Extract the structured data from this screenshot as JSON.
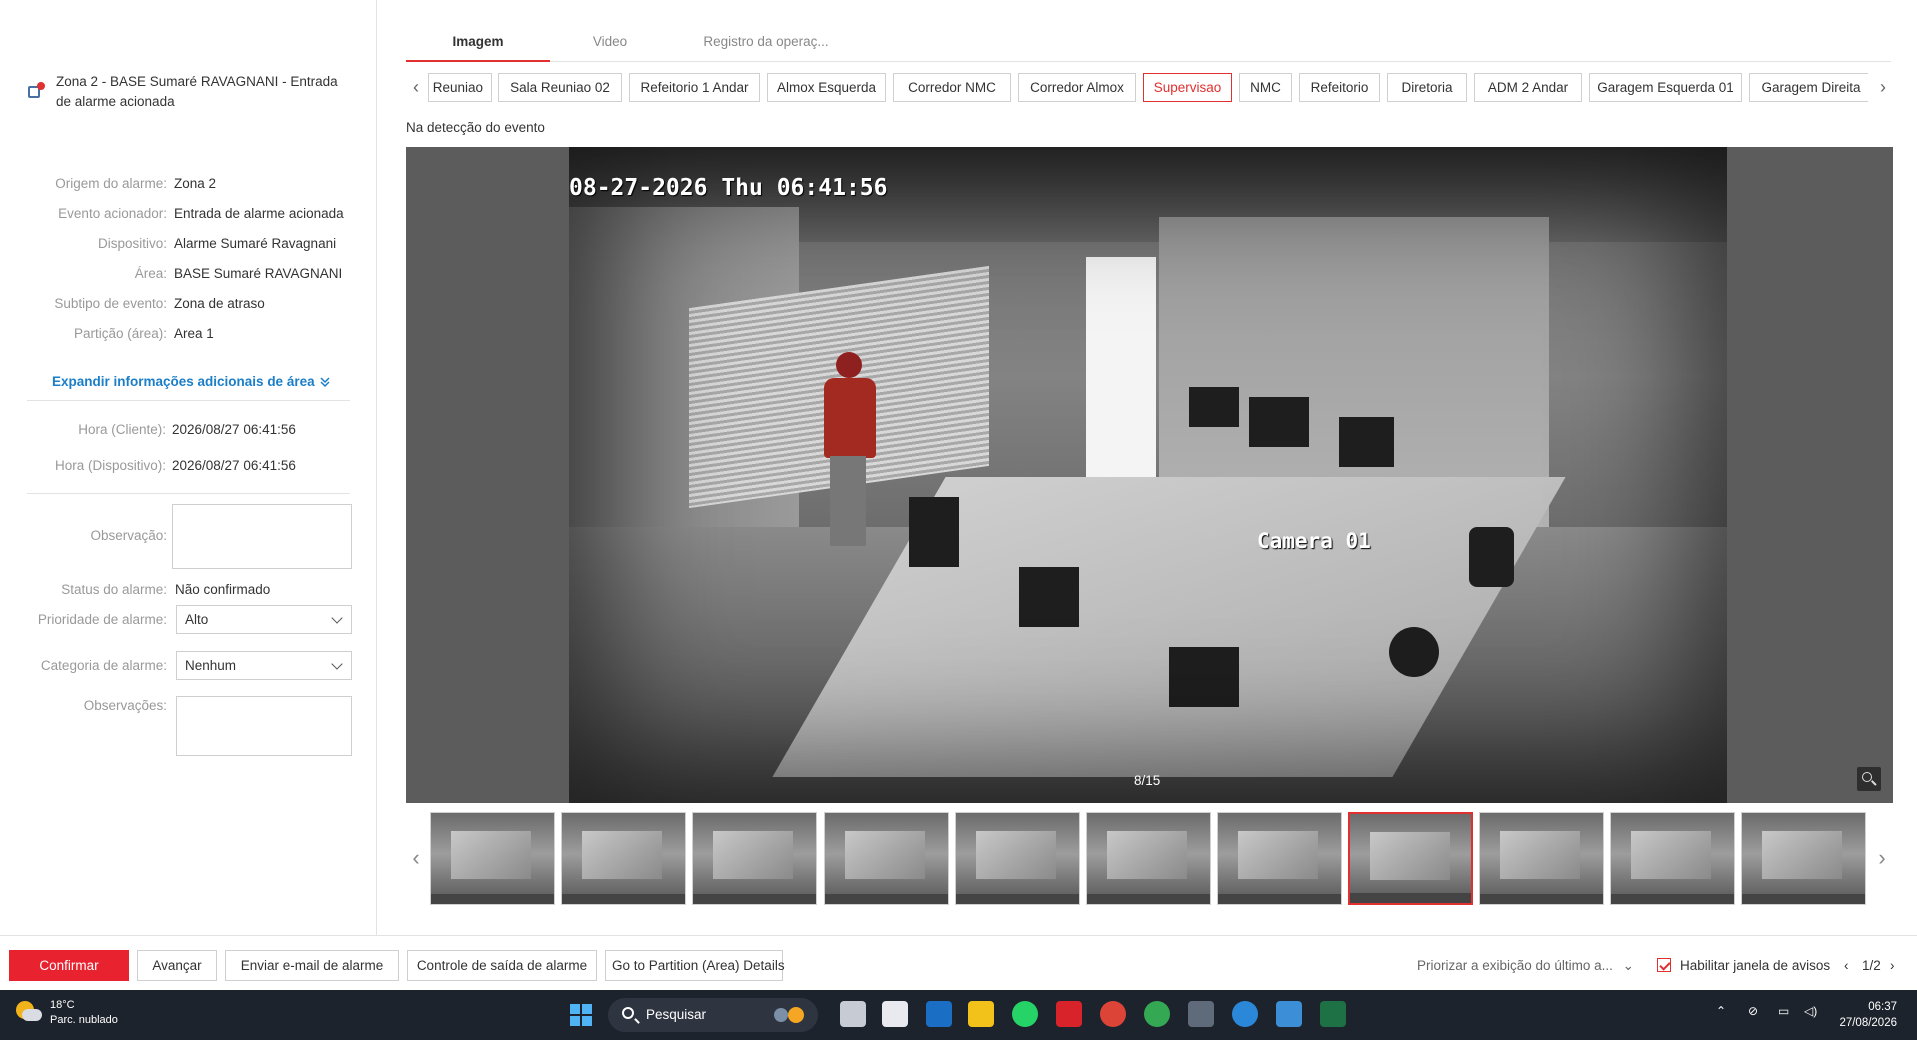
{
  "alarm": {
    "title": "Zona 2 - BASE Sumaré RAVAGNANI - Entrada de alarme acionada"
  },
  "details": [
    {
      "label": "Origem do alarme:",
      "value": "Zona 2"
    },
    {
      "label": "Evento acionador:",
      "value": "Entrada de alarme acionada"
    },
    {
      "label": "Dispositivo:",
      "value": "Alarme Sumaré Ravagnani"
    },
    {
      "label": "Área:",
      "value": "BASE Sumaré RAVAGNANI"
    },
    {
      "label": "Subtipo de evento:",
      "value": "Zona de atraso"
    },
    {
      "label": "Partição (área):",
      "value": "Area 1"
    }
  ],
  "expand_label": "Expandir informações adicionais de área",
  "times": [
    {
      "label": "Hora (Cliente):",
      "value": "2026/08/27 06:41:56"
    },
    {
      "label": "Hora (Dispositivo):",
      "value": "2026/08/27 06:41:56"
    }
  ],
  "form": {
    "observacao_label": "Observação:",
    "status_label": "Status do alarme:",
    "status_value": "Não confirmado",
    "priority_label": "Prioridade de alarme:",
    "priority_value": "Alto",
    "category_label": "Categoria de alarme:",
    "category_value": "Nenhum",
    "observacoes_label": "Observações:"
  },
  "tabs": [
    {
      "label": "Imagem",
      "active": true
    },
    {
      "label": "Video",
      "active": false
    },
    {
      "label": "Registro da operaç...",
      "active": false
    }
  ],
  "cameras": [
    {
      "label": "Reuniao",
      "active": false
    },
    {
      "label": "Sala Reuniao 02",
      "active": false
    },
    {
      "label": "Refeitorio 1 Andar",
      "active": false
    },
    {
      "label": "Almox Esquerda",
      "active": false
    },
    {
      "label": "Corredor NMC",
      "active": false
    },
    {
      "label": "Corredor Almox",
      "active": false
    },
    {
      "label": "Supervisao",
      "active": true
    },
    {
      "label": "NMC",
      "active": false
    },
    {
      "label": "Refeitorio",
      "active": false
    },
    {
      "label": "Diretoria",
      "active": false
    },
    {
      "label": "ADM 2 Andar",
      "active": false
    },
    {
      "label": "Garagem Esquerda 01",
      "active": false
    },
    {
      "label": "Garagem Direita",
      "active": false
    }
  ],
  "event_caption": "Na detecção do evento",
  "video": {
    "timestamp": "08-27-2026 Thu 06:41:56",
    "camera_label": "Camera 01",
    "frame_counter": "8/15"
  },
  "thumbnails": {
    "count": 11,
    "active_index": 7
  },
  "footer": {
    "confirm": "Confirmar",
    "next": "Avançar",
    "email": "Enviar e-mail de alarme",
    "output": "Controle de saída de alarme",
    "partition": "Go to Partition (Area) Details",
    "priority_display": "Priorizar a exibição do último a...",
    "enable_popup": "Habilitar janela de avisos",
    "page": "1/2"
  },
  "taskbar": {
    "temperature": "18°C",
    "weather": "Parc. nublado",
    "search": "Pesquisar",
    "time": "06:37",
    "date": "27/08/2026"
  },
  "colors": {
    "accent": "#e8222f",
    "link": "#1a7ec8",
    "taskbar": "#1d232c"
  }
}
